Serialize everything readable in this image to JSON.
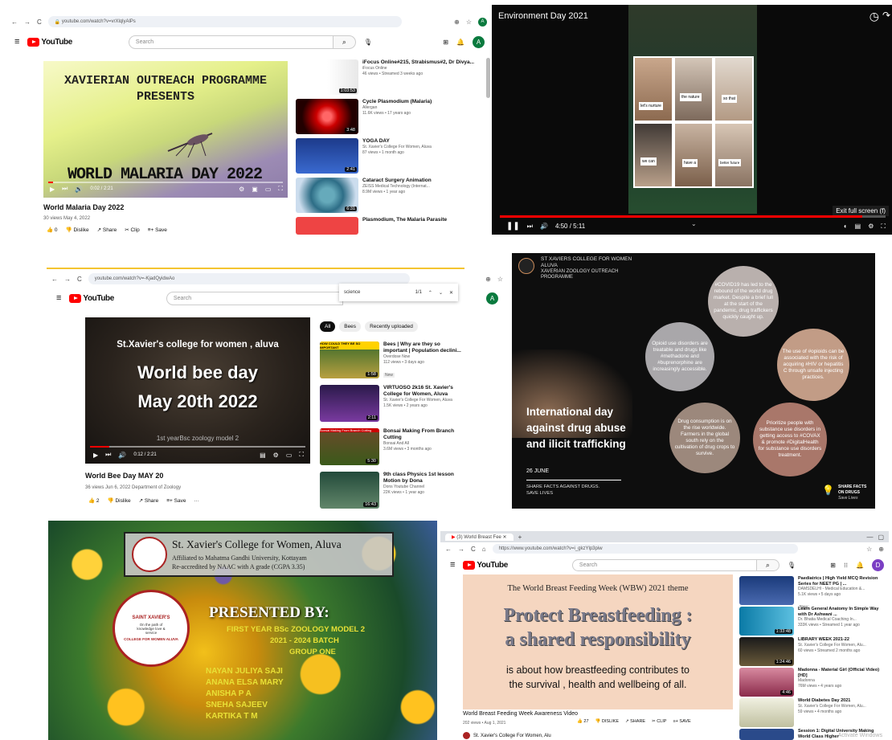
{
  "p1": {
    "url": "youtube.com/watch?v=vrXlqlyAlPs",
    "search_placeholder": "Search",
    "avatar": "A",
    "video_title": "World Malaria Day 2022",
    "views": "30 views  May 4, 2022",
    "heading1": "XAVIERIAN OUTREACH PROGRAMME",
    "heading2": "PRESENTS",
    "banner": "WORLD MALARIA DAY 2022",
    "time": "0:02 / 2:21",
    "likes": "0",
    "dislike": "Dislike",
    "share": "Share",
    "clip": "Clip",
    "save": "Save",
    "side": [
      {
        "title": "iFocus Online#215, Strabismus#2, Dr Divya...",
        "channel": "iFocus Online",
        "meta": "46 views • Streamed 3 weeks ago",
        "dur": "1:03:53"
      },
      {
        "title": "Cycle Plasmodium (Malaria)",
        "channel": "Allergan",
        "meta": "11.6K views • 17 years ago",
        "dur": "3:48"
      },
      {
        "title": "YOGA DAY",
        "channel": "St. Xavier's College For Women, Aluva",
        "meta": "87 views • 1 month ago",
        "dur": "2:41"
      },
      {
        "title": "Cataract Surgery Animation",
        "channel": "ZEISS Medical Technology (Internat...",
        "meta": "8.9M views • 1 year ago",
        "dur": "6:31"
      },
      {
        "title": "Plasmodium, The Malaria Parasite",
        "channel": "",
        "meta": "",
        "dur": ""
      }
    ]
  },
  "p2": {
    "title": "Environment Day 2021",
    "cards": [
      "let's nurture",
      "the nature",
      "so that",
      "we can",
      "have a",
      "better future"
    ],
    "tooltip": "Exit full screen (f)",
    "time": "4:50 / 5:11"
  },
  "p3": {
    "url": "youtube.com/watch?v=-KjadQyidwAo",
    "search_placeholder": "Search",
    "find_text": "science",
    "find_count": "1/1",
    "avatar": "A",
    "line1": "St.Xavier's college for women , aluva",
    "line2": "World bee day",
    "line3": "May 20th 2022",
    "subline": "1st yearBsc zoology model 2",
    "time": "0:12 / 2:21",
    "video_title": "World Bee Day MAY 20",
    "views": "36 views  Jun 6, 2022  Department of Zoology",
    "likes": "2",
    "dislike": "Dislike",
    "share": "Share",
    "save": "Save",
    "chips": [
      "All",
      "Bees",
      "Recently uploaded"
    ],
    "side": [
      {
        "title": "Bees | Why are they so important | Population declini...",
        "channel": "Overdose Now",
        "meta": "112 views • 3 days ago",
        "dur": "1:58",
        "badge": "New",
        "thumbtext": "HOW COULD THEY BE SO IMPORTANT"
      },
      {
        "title": "VIRTUOSO 2k16 St. Xavier's College for Women, Aluva",
        "channel": "St. Xavier's College For Women, Aluva",
        "meta": "1.5K views • 2 years ago",
        "dur": "2:11",
        "badge": "",
        "thumbtext": ""
      },
      {
        "title": "Bonsai Making From Branch Cutting",
        "channel": "Bonsai And All",
        "meta": "3.6M views • 3 months ago",
        "dur": "5:30",
        "badge": "",
        "thumbtext": "Bonsai Making From Branch Cutting"
      },
      {
        "title": "9th class Physics 1st lesson Motion by Dona",
        "channel": "Dons Youtube Channel",
        "meta": "22K views • 1 year ago",
        "dur": "16:43",
        "badge": "",
        "thumbtext": ""
      }
    ]
  },
  "p4": {
    "org1": "ST XAVIERS COLLEGE FOR WOMEN",
    "org2": "ALUVA",
    "org3": "XAVERIAN ZOOLOGY OUTREACH",
    "org4": "PROGRAMME",
    "c1": "#COVID19 has led to the rebound of the world drug market. Despite a brief lull at the start of the pandemic, drug traffickers quickly caught up.",
    "c2": "Opioid use disorders are treatable and drugs like #methadone and #buprenorphine are increasingly accessible.",
    "c3": "The use of #opioids can be associated with the risk of acquiring #HIV or hepatitis C through unsafe injecting practices.",
    "c4": "Drug consumption is on the rise worldwide. Farmers in the global south rely on the cultivation of drug crops to survive.",
    "c5": "Prioritize people with substance use disorders in getting access to #COVAX & promote #DigitalHealth for substance use disorders treatment.",
    "big": "International day against drug abuse and ilicit trafficking",
    "date": "26 JUNE",
    "share1": "SHARE FACTS AGAINST DRUGS.",
    "share2": "SAVE LIVES",
    "logo1": "SHARE FACTS",
    "logo2": "ON DRUGS",
    "logo3": "Save Lives"
  },
  "p5": {
    "college": "St. Xavier's College for Women, Aluva",
    "aff": "Affiliated to Mahatma Gandhi University, Kottayam",
    "accr": "Re-accredited by NAAC with A grade (CGPA 3.35)",
    "seal_top": "SAINT XAVIER'S",
    "seal_bottom": "COLLEGE FOR WOMEN ALUVA",
    "seal_motto": "On the path of knowledge love & service",
    "presented": "PRESENTED BY:",
    "l1": "FIRST YEAR BSc ZOOLOGY MODEL 2",
    "l2": "2021 - 2024 BATCH",
    "l3": "GROUP ONE",
    "names": [
      "NAYAN JULIYA SAJI",
      "ANANA ELSA MARY",
      "ANISHA P A",
      "SNEHA SAJEEV",
      "KARTIKA T M"
    ]
  },
  "p6": {
    "tab": "(3) World Breast Fee",
    "url": "https://www.youtube.com/watch?v=i_gkzYlp3piw",
    "search_placeholder": "Search",
    "avatar": "D",
    "theme": "The World Breast Feeding Week (WBW) 2021 theme",
    "big1": "Protect Breastfeeding :",
    "big2": "a shared responsibility",
    "desc1": "is about how breastfeeding contributes to",
    "desc2": "the survival , health and wellbeing of all.",
    "video_title": "World Breast Feeding Week Awareness Video",
    "views": "202 views • Aug 1, 2021",
    "likes": "27",
    "dislike": "DISLIKE",
    "share": "SHARE",
    "clip": "CLIP",
    "save": "SAVE",
    "channel": "St. Xavier's College For Women, Alu",
    "side": [
      {
        "title": "Paediatrics | High Yield MCQ Revision Series for NEET PG | ...",
        "channel": "DAMSDELHI - Medical Education &...",
        "meta": "5.1K views • 5 days ago",
        "badge": "New",
        "dur": ""
      },
      {
        "title": "Learn General Anatomy In Simple Way with Dr Ashwani ...",
        "channel": "Dr. Bhatia Medical Coaching In...",
        "meta": "333K views • Streamed 1 year ago",
        "badge": "",
        "dur": "1:33:48"
      },
      {
        "title": "LIBRARY WEEK 2021-22",
        "channel": "St. Xavier's College For Women, Alu...",
        "meta": "60 views • Streamed 2 months ago",
        "badge": "",
        "dur": "1:24:46"
      },
      {
        "title": "Madonna - Material Girl (Official Video) [HD]",
        "channel": "Madonna",
        "meta": "76M views • 4 years ago",
        "badge": "",
        "dur": "4:46"
      },
      {
        "title": "World Diabetes Day 2021",
        "channel": "St. Xavier's College For Women, Alu...",
        "meta": "59 views • 4 months ago",
        "badge": "",
        "dur": ""
      },
      {
        "title": "Session 1: Digital University Making World Class Higher",
        "channel": "",
        "meta": "",
        "badge": "",
        "dur": ""
      }
    ],
    "watermark": "Activate Windows"
  }
}
